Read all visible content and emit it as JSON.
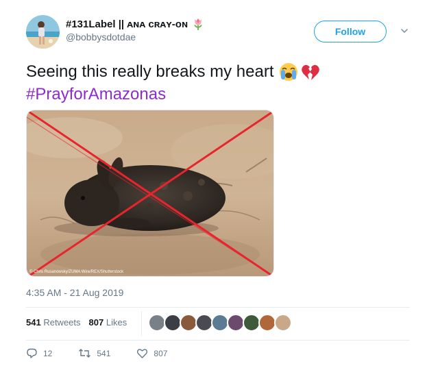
{
  "author": {
    "display_name": "#131Label || ᴀɴᴀ ᴄʀᴀʏ-ᴏɴ",
    "handle": "@bobbysdotdae",
    "name_emoji": "tulip-icon"
  },
  "follow": {
    "label": "Follow"
  },
  "tweet": {
    "text_line1": "Seeing this really breaks my heart",
    "emojis": [
      "loudly-crying-face-icon",
      "broken-heart-icon"
    ],
    "hashtag": "#PrayforAmazonas"
  },
  "media": {
    "credit": "© Chris Rusanowsky/ZUMA Wire/REX/Shutterstock"
  },
  "timestamp": "4:35 AM - 21 Aug 2019",
  "stats": {
    "retweets_count": "541",
    "retweets_label": "Retweets",
    "likes_count": "807",
    "likes_label": "Likes"
  },
  "likers_count": 9,
  "actions": {
    "reply_count": "12",
    "retweet_count": "541",
    "like_count": "807"
  },
  "colors": {
    "accent": "#1da1f2",
    "hashtag": "#8e2bd0",
    "muted": "#657786",
    "cross": "#e8242d"
  }
}
